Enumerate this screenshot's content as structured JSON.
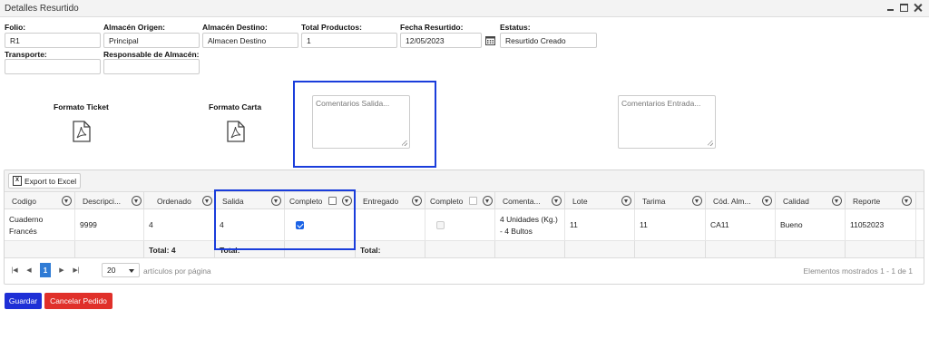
{
  "window": {
    "title": "Detalles Resurtido"
  },
  "form": {
    "folio": {
      "label": "Folio:",
      "value": "R1"
    },
    "almacen_origen": {
      "label": "Almacén Origen:",
      "value": "Principal"
    },
    "almacen_destino": {
      "label": "Almacén Destino:",
      "value": "Almacen Destino"
    },
    "total_productos": {
      "label": "Total Productos:",
      "value": "1"
    },
    "fecha_resurtido": {
      "label": "Fecha Resurtido:",
      "value": "12/05/2023"
    },
    "estatus": {
      "label": "Estatus:",
      "value": "Resurtido Creado"
    },
    "transporte": {
      "label": "Transporte:",
      "value": ""
    },
    "responsable": {
      "label": "Responsable de Almacén:",
      "value": ""
    }
  },
  "formats": {
    "ticket_label": "Formato Ticket",
    "carta_label": "Formato Carta",
    "icon": "pdf-icon"
  },
  "comments": {
    "salida_placeholder": "Comentarios Salida...",
    "entrada_placeholder": "Comentarios Entrada..."
  },
  "grid": {
    "export_label": "Export to Excel",
    "columns": [
      "Codigo",
      "Descripci...",
      "Ordenado",
      "Salida",
      "Completo",
      "Entregado",
      "Completo",
      "Comenta...",
      "Lote",
      "Tarima",
      "Cód. Alm...",
      "Calidad",
      "Reporte"
    ],
    "rows": [
      {
        "codigo": "Cuaderno Francés",
        "descripcion": "9999",
        "ordenado": "4",
        "salida": "4",
        "completo_salida": true,
        "entregado": "",
        "completo_entrega": false,
        "comentarios": "4 Unidades (Kg.) - 4 Bultos",
        "lote": "11",
        "tarima": "11",
        "cod_almacen": "CA11",
        "calidad": "Bueno",
        "reporte": "11052023"
      }
    ],
    "footer": {
      "ordenado_total": "Total: 4",
      "salida_total": "Total:",
      "entregado_total": "Total:"
    }
  },
  "pager": {
    "current_page": "1",
    "page_size": "20",
    "per_page_label": "artículos por página",
    "summary": "Elementos mostrados 1 - 1 de 1"
  },
  "actions": {
    "guardar": "Guardar",
    "cancelar": "Cancelar Pedido"
  },
  "colors": {
    "accent_blue": "#1a3ddb",
    "guardar_bg": "#1e2fd6",
    "cancelar_bg": "#e0302a",
    "page_active": "#2f7bd5",
    "checkbox_on": "#1a62e6"
  }
}
